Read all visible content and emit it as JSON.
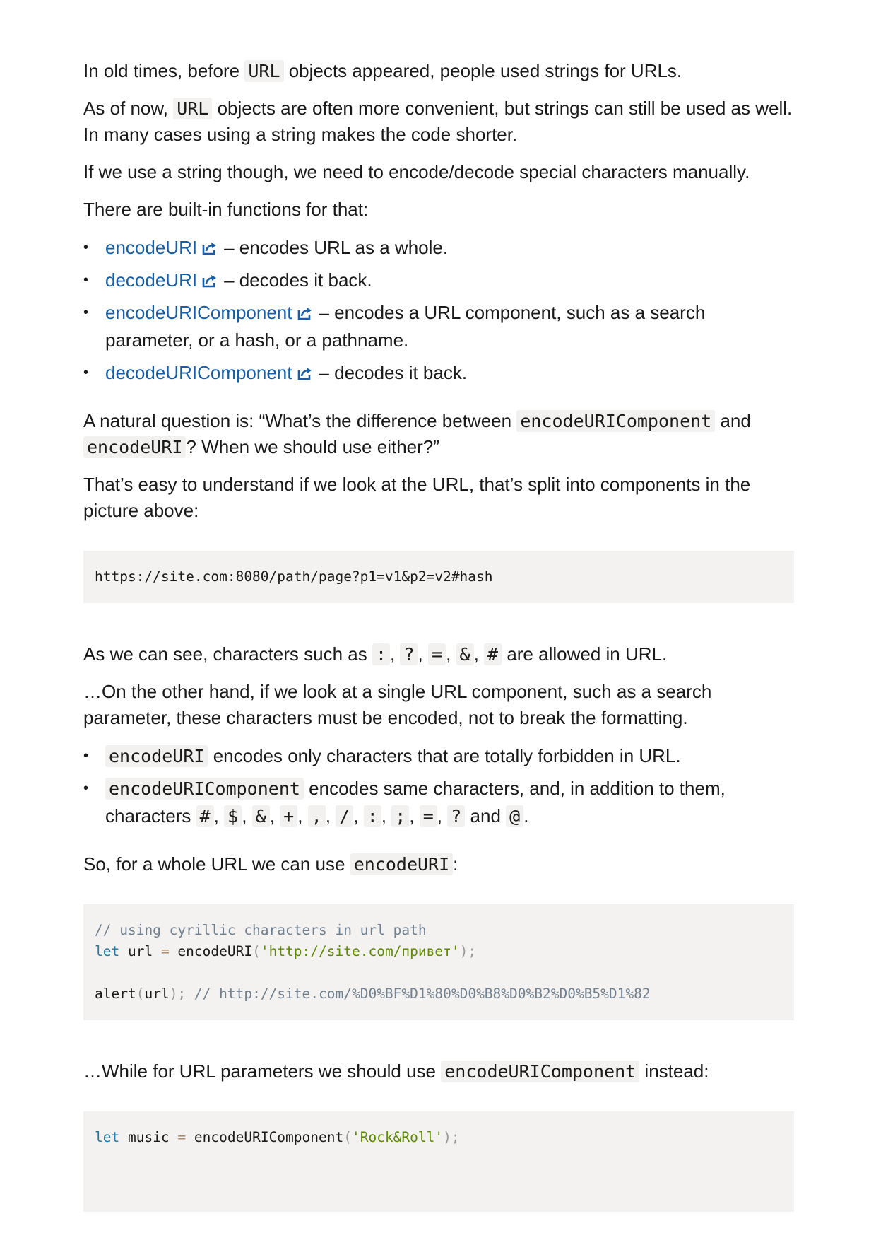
{
  "p1": {
    "a": "In old times, before ",
    "code": "URL",
    "b": " objects appeared, people used strings for URLs."
  },
  "p2": {
    "a": "As of now, ",
    "code": "URL",
    "b": " objects are often more convenient, but strings can still be used as well. In many cases using a string makes the code shorter."
  },
  "p3": "If we use a string though, we need to encode/decode special characters manually.",
  "p4": "There are built-in functions for that:",
  "functions": [
    {
      "name": "encodeURI",
      "desc": "– encodes URL as a whole."
    },
    {
      "name": "decodeURI",
      "desc": "– decodes it back."
    },
    {
      "name": "encodeURIComponent",
      "desc": "– encodes a URL component, such as a search parameter, or a hash, or a pathname."
    },
    {
      "name": "decodeURIComponent",
      "desc": "– decodes it back."
    }
  ],
  "p5": {
    "a": "A natural question is: “What’s the difference between ",
    "code1": "encodeURIComponent",
    "b": " and ",
    "code2": "encodeURI",
    "c": "? When we should use either?”"
  },
  "p6": "That’s easy to understand if we look at the URL, that’s split into components in the picture above:",
  "code_url": "https://site.com:8080/path/page?p1=v1&p2=v2#hash",
  "p7": {
    "a": "As we can see, characters such as ",
    "chars": [
      ":",
      "?",
      "=",
      "&",
      "#"
    ],
    "b": " are allowed in URL."
  },
  "p8": "…On the other hand, if we look at a single URL component, such as a search parameter, these characters must be encoded, not to break the formatting.",
  "bullets2": [
    {
      "code": "encodeURI",
      "text": " encodes only characters that are totally forbidden in URL."
    },
    {
      "code": "encodeURIComponent",
      "text": " encodes same characters, and, in addition to them, characters ",
      "chars": [
        "#",
        "$",
        "&",
        "+",
        ",",
        "/",
        ":",
        ";",
        "=",
        "?"
      ],
      "and": " and ",
      "last": "@",
      "end": "."
    }
  ],
  "p9": {
    "a": "So, for a whole URL we can use ",
    "code": "encodeURI",
    "b": ":"
  },
  "code1": {
    "comment1": "// using cyrillic characters in url path",
    "kw_let": "let",
    "var_url": " url ",
    "eq": "=",
    "fn": " encodeURI",
    "lp": "(",
    "str": "'http://site.com/привет'",
    "rp": ");",
    "alert": "alert",
    "lp2": "(",
    "arg": "url",
    "rp2": ");",
    "comment2": " // http://site.com/%D0%BF%D1%80%D0%B8%D0%B2%D0%B5%D1%82"
  },
  "p10": {
    "a": "…While for URL parameters we should use ",
    "code": "encodeURIComponent",
    "b": " instead:"
  },
  "code2": {
    "kw_let": "let",
    "var_music": " music ",
    "eq": "=",
    "fn": " encodeURIComponent",
    "lp": "(",
    "str": "'Rock&Roll'",
    "rp": ");"
  },
  "colors": {
    "link": "#175ea8",
    "code_bg": "#f4f2f0",
    "comment": "#708090",
    "keyword": "#2476a3",
    "string": "#5c8a00"
  },
  "icons": {
    "external_link": "external-link-icon"
  }
}
